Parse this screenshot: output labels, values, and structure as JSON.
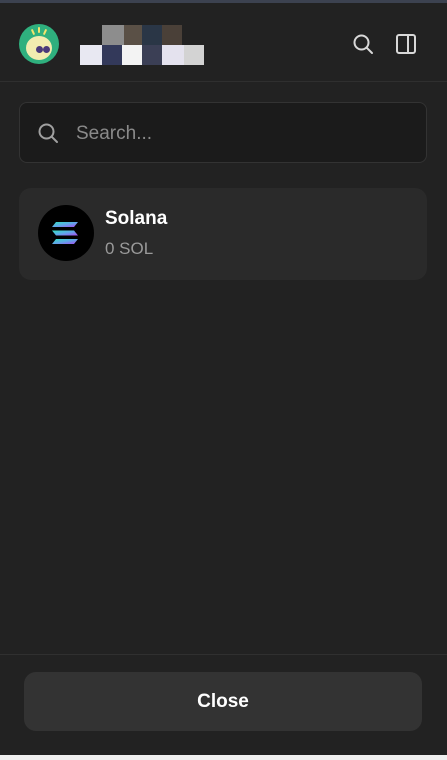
{
  "header": {
    "avatar_icon": "ghost-avatar-icon",
    "account_name_redacted": true,
    "search_icon": "search-icon",
    "sidebar_icon": "sidebar-panel-icon"
  },
  "search": {
    "placeholder": "Search...",
    "value": ""
  },
  "tokens": [
    {
      "name": "Solana",
      "balance": "0 SOL",
      "icon": "solana-logo-icon"
    }
  ],
  "footer": {
    "close_label": "Close"
  },
  "colors": {
    "background": "#222222",
    "card": "#2a2a2a",
    "button": "#333333",
    "text_primary": "#ffffff",
    "text_secondary": "#9a9a9a"
  }
}
